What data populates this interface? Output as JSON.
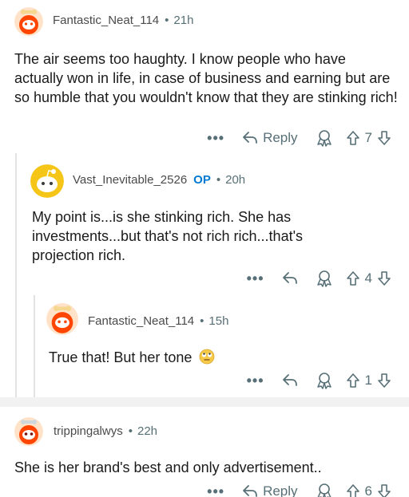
{
  "comments": [
    {
      "username": "Fantastic_Neat_114",
      "time": "21h",
      "text": "The air seems too haughty. I know people who have actually won in life, in case of business and earning but are so humble that you wouldn't know that they are stinking rich!",
      "more": "•••",
      "reply": "Reply",
      "score": "7"
    },
    {
      "username": "Vast_Inevitable_2526",
      "op_badge": "OP",
      "time": "20h",
      "text": "My point is...is she stinking rich. She has investments...but that's not rich rich...that's projection rich.",
      "more": "•••",
      "score": "4"
    },
    {
      "username": "Fantastic_Neat_114",
      "time": "15h",
      "text": "True that! But her tone",
      "more": "•••",
      "score": "1"
    },
    {
      "username": "trippingalwys",
      "time": "22h",
      "text": "She is her brand's best and only advertisement..",
      "more": "•••",
      "reply": "Reply",
      "score": "6"
    }
  ],
  "separator_dot": "•",
  "colors": {
    "meta": "#576f76",
    "op": "#0079d3",
    "avatar_orange": "#ff4500",
    "avatar_yellow": "#f5c518",
    "thread_line": "#e3e3e3"
  }
}
